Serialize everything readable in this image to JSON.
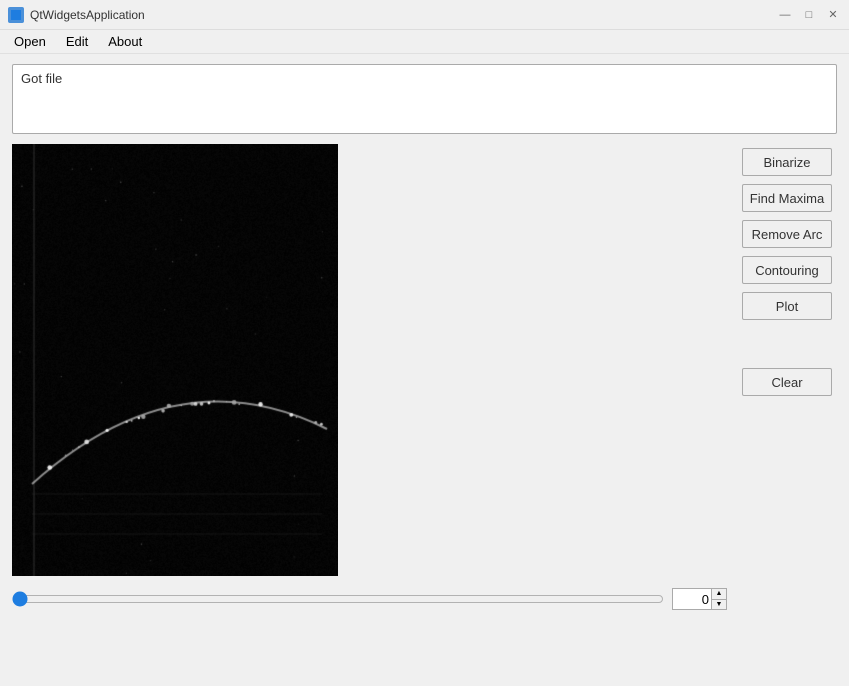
{
  "window": {
    "title": "QtWidgetsApplication",
    "icon": "app-icon"
  },
  "titlebar": {
    "minimize_label": "—",
    "maximize_label": "□",
    "close_label": "✕"
  },
  "menubar": {
    "items": [
      {
        "id": "open",
        "label": "Open"
      },
      {
        "id": "edit",
        "label": "Edit"
      },
      {
        "id": "about",
        "label": "About"
      }
    ]
  },
  "log": {
    "text": "Got file"
  },
  "buttons": {
    "binarize": "Binarize",
    "find_maxima": "Find Maxima",
    "remove_arc": "Remove Arc",
    "contouring": "Contouring",
    "plot": "Plot",
    "clear": "Clear"
  },
  "slider": {
    "value": "0",
    "min": 0,
    "max": 100
  }
}
